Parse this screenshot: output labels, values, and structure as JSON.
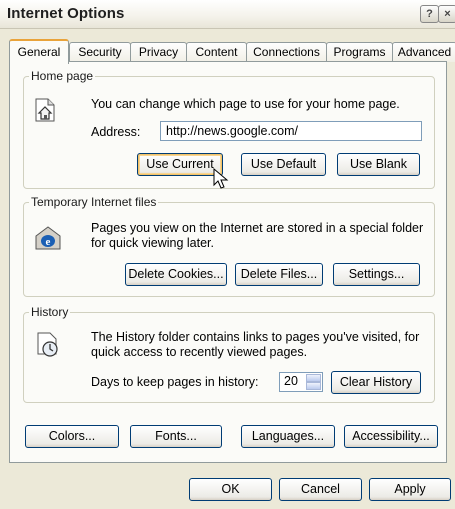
{
  "window": {
    "title": "Internet Options"
  },
  "title_buttons": {
    "help": "?",
    "close": "×"
  },
  "tabs": [
    {
      "label": "General",
      "active": true
    },
    {
      "label": "Security",
      "active": false
    },
    {
      "label": "Privacy",
      "active": false
    },
    {
      "label": "Content",
      "active": false
    },
    {
      "label": "Connections",
      "active": false
    },
    {
      "label": "Programs",
      "active": false
    },
    {
      "label": "Advanced",
      "active": false
    }
  ],
  "home_page": {
    "legend": "Home page",
    "description": "You can change which page to use for your home page.",
    "address_label": "Address:",
    "address_value": "http://news.google.com/",
    "use_current": "Use Current",
    "use_default": "Use Default",
    "use_blank": "Use Blank"
  },
  "temp_files": {
    "legend": "Temporary Internet files",
    "description_line1": "Pages you view on the Internet are stored in a special folder",
    "description_line2": "for quick viewing later.",
    "delete_cookies": "Delete Cookies...",
    "delete_files": "Delete Files...",
    "settings": "Settings..."
  },
  "history": {
    "legend": "History",
    "description_line1": "The History folder contains links to pages you've visited, for",
    "description_line2": "quick access to recently viewed pages.",
    "days_label": "Days to keep pages in history:",
    "days_value": "20",
    "clear_history": "Clear History"
  },
  "bottom_row": {
    "colors": "Colors...",
    "fonts": "Fonts...",
    "languages": "Languages...",
    "accessibility": "Accessibility..."
  },
  "dialog_buttons": {
    "ok": "OK",
    "cancel": "Cancel",
    "apply": "Apply"
  },
  "colors": {
    "focus_accent": "#e9a33a",
    "button_border": "#003c74",
    "dialog_bg": "#ece9d8"
  }
}
